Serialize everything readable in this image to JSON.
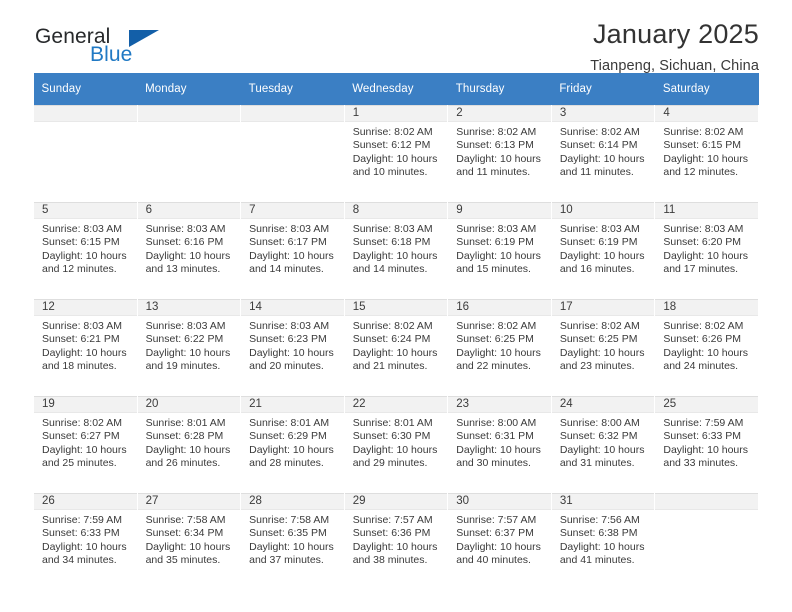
{
  "brand": {
    "name_part1": "General",
    "name_part2": "Blue",
    "triangle_color": "#135fa8",
    "blue_color": "#2079c4"
  },
  "header": {
    "title": "January 2025",
    "subtitle": "Tianpeng, Sichuan, China"
  },
  "theme": {
    "header_row_bg": "#3b7fc4",
    "header_row_text": "#ffffff",
    "daynum_band_bg": "#f2f2f2"
  },
  "calendar": {
    "weekday_headers": [
      "Sunday",
      "Monday",
      "Tuesday",
      "Wednesday",
      "Thursday",
      "Friday",
      "Saturday"
    ],
    "weeks": [
      [
        {
          "day": "",
          "empty": true
        },
        {
          "day": "",
          "empty": true
        },
        {
          "day": "",
          "empty": true
        },
        {
          "day": "1",
          "sunrise": "Sunrise: 8:02 AM",
          "sunset": "Sunset: 6:12 PM",
          "daylight": "Daylight: 10 hours and 10 minutes."
        },
        {
          "day": "2",
          "sunrise": "Sunrise: 8:02 AM",
          "sunset": "Sunset: 6:13 PM",
          "daylight": "Daylight: 10 hours and 11 minutes."
        },
        {
          "day": "3",
          "sunrise": "Sunrise: 8:02 AM",
          "sunset": "Sunset: 6:14 PM",
          "daylight": "Daylight: 10 hours and 11 minutes."
        },
        {
          "day": "4",
          "sunrise": "Sunrise: 8:02 AM",
          "sunset": "Sunset: 6:15 PM",
          "daylight": "Daylight: 10 hours and 12 minutes."
        }
      ],
      [
        {
          "day": "5",
          "sunrise": "Sunrise: 8:03 AM",
          "sunset": "Sunset: 6:15 PM",
          "daylight": "Daylight: 10 hours and 12 minutes."
        },
        {
          "day": "6",
          "sunrise": "Sunrise: 8:03 AM",
          "sunset": "Sunset: 6:16 PM",
          "daylight": "Daylight: 10 hours and 13 minutes."
        },
        {
          "day": "7",
          "sunrise": "Sunrise: 8:03 AM",
          "sunset": "Sunset: 6:17 PM",
          "daylight": "Daylight: 10 hours and 14 minutes."
        },
        {
          "day": "8",
          "sunrise": "Sunrise: 8:03 AM",
          "sunset": "Sunset: 6:18 PM",
          "daylight": "Daylight: 10 hours and 14 minutes."
        },
        {
          "day": "9",
          "sunrise": "Sunrise: 8:03 AM",
          "sunset": "Sunset: 6:19 PM",
          "daylight": "Daylight: 10 hours and 15 minutes."
        },
        {
          "day": "10",
          "sunrise": "Sunrise: 8:03 AM",
          "sunset": "Sunset: 6:19 PM",
          "daylight": "Daylight: 10 hours and 16 minutes."
        },
        {
          "day": "11",
          "sunrise": "Sunrise: 8:03 AM",
          "sunset": "Sunset: 6:20 PM",
          "daylight": "Daylight: 10 hours and 17 minutes."
        }
      ],
      [
        {
          "day": "12",
          "sunrise": "Sunrise: 8:03 AM",
          "sunset": "Sunset: 6:21 PM",
          "daylight": "Daylight: 10 hours and 18 minutes."
        },
        {
          "day": "13",
          "sunrise": "Sunrise: 8:03 AM",
          "sunset": "Sunset: 6:22 PM",
          "daylight": "Daylight: 10 hours and 19 minutes."
        },
        {
          "day": "14",
          "sunrise": "Sunrise: 8:03 AM",
          "sunset": "Sunset: 6:23 PM",
          "daylight": "Daylight: 10 hours and 20 minutes."
        },
        {
          "day": "15",
          "sunrise": "Sunrise: 8:02 AM",
          "sunset": "Sunset: 6:24 PM",
          "daylight": "Daylight: 10 hours and 21 minutes."
        },
        {
          "day": "16",
          "sunrise": "Sunrise: 8:02 AM",
          "sunset": "Sunset: 6:25 PM",
          "daylight": "Daylight: 10 hours and 22 minutes."
        },
        {
          "day": "17",
          "sunrise": "Sunrise: 8:02 AM",
          "sunset": "Sunset: 6:25 PM",
          "daylight": "Daylight: 10 hours and 23 minutes."
        },
        {
          "day": "18",
          "sunrise": "Sunrise: 8:02 AM",
          "sunset": "Sunset: 6:26 PM",
          "daylight": "Daylight: 10 hours and 24 minutes."
        }
      ],
      [
        {
          "day": "19",
          "sunrise": "Sunrise: 8:02 AM",
          "sunset": "Sunset: 6:27 PM",
          "daylight": "Daylight: 10 hours and 25 minutes."
        },
        {
          "day": "20",
          "sunrise": "Sunrise: 8:01 AM",
          "sunset": "Sunset: 6:28 PM",
          "daylight": "Daylight: 10 hours and 26 minutes."
        },
        {
          "day": "21",
          "sunrise": "Sunrise: 8:01 AM",
          "sunset": "Sunset: 6:29 PM",
          "daylight": "Daylight: 10 hours and 28 minutes."
        },
        {
          "day": "22",
          "sunrise": "Sunrise: 8:01 AM",
          "sunset": "Sunset: 6:30 PM",
          "daylight": "Daylight: 10 hours and 29 minutes."
        },
        {
          "day": "23",
          "sunrise": "Sunrise: 8:00 AM",
          "sunset": "Sunset: 6:31 PM",
          "daylight": "Daylight: 10 hours and 30 minutes."
        },
        {
          "day": "24",
          "sunrise": "Sunrise: 8:00 AM",
          "sunset": "Sunset: 6:32 PM",
          "daylight": "Daylight: 10 hours and 31 minutes."
        },
        {
          "day": "25",
          "sunrise": "Sunrise: 7:59 AM",
          "sunset": "Sunset: 6:33 PM",
          "daylight": "Daylight: 10 hours and 33 minutes."
        }
      ],
      [
        {
          "day": "26",
          "sunrise": "Sunrise: 7:59 AM",
          "sunset": "Sunset: 6:33 PM",
          "daylight": "Daylight: 10 hours and 34 minutes."
        },
        {
          "day": "27",
          "sunrise": "Sunrise: 7:58 AM",
          "sunset": "Sunset: 6:34 PM",
          "daylight": "Daylight: 10 hours and 35 minutes."
        },
        {
          "day": "28",
          "sunrise": "Sunrise: 7:58 AM",
          "sunset": "Sunset: 6:35 PM",
          "daylight": "Daylight: 10 hours and 37 minutes."
        },
        {
          "day": "29",
          "sunrise": "Sunrise: 7:57 AM",
          "sunset": "Sunset: 6:36 PM",
          "daylight": "Daylight: 10 hours and 38 minutes."
        },
        {
          "day": "30",
          "sunrise": "Sunrise: 7:57 AM",
          "sunset": "Sunset: 6:37 PM",
          "daylight": "Daylight: 10 hours and 40 minutes."
        },
        {
          "day": "31",
          "sunrise": "Sunrise: 7:56 AM",
          "sunset": "Sunset: 6:38 PM",
          "daylight": "Daylight: 10 hours and 41 minutes."
        },
        {
          "day": "",
          "empty": true
        }
      ]
    ]
  }
}
